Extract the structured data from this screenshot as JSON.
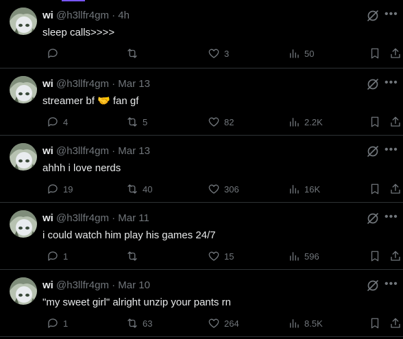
{
  "colors": {
    "text": "#e7e9ea",
    "muted": "#71767b",
    "border": "#2f3336",
    "accent": "#7856ff"
  },
  "icons": [
    "reply-icon",
    "retweet-icon",
    "like-icon",
    "views-icon",
    "bookmark-icon",
    "share-icon",
    "grok-icon",
    "more-icon"
  ],
  "tweets": [
    {
      "name": "wi",
      "handle": "@h3llfr4gm",
      "sep": "·",
      "time": "4h",
      "text": "sleep calls>>>>",
      "replies": "",
      "retweets": "",
      "likes": "3",
      "views": "50"
    },
    {
      "name": "wi",
      "handle": "@h3llfr4gm",
      "sep": "·",
      "time": "Mar 13",
      "text": "streamer bf 🤝 fan gf",
      "replies": "4",
      "retweets": "5",
      "likes": "82",
      "views": "2.2K"
    },
    {
      "name": "wi",
      "handle": "@h3llfr4gm",
      "sep": "·",
      "time": "Mar 13",
      "text": "ahhh i love nerds",
      "replies": "19",
      "retweets": "40",
      "likes": "306",
      "views": "16K"
    },
    {
      "name": "wi",
      "handle": "@h3llfr4gm",
      "sep": "·",
      "time": "Mar 11",
      "text": "i could watch him play his games 24/7",
      "replies": "1",
      "retweets": "",
      "likes": "15",
      "views": "596"
    },
    {
      "name": "wi",
      "handle": "@h3llfr4gm",
      "sep": "·",
      "time": "Mar 10",
      "text": "\"my sweet girl\" alright unzip your pants rn",
      "replies": "1",
      "retweets": "63",
      "likes": "264",
      "views": "8.5K"
    }
  ]
}
